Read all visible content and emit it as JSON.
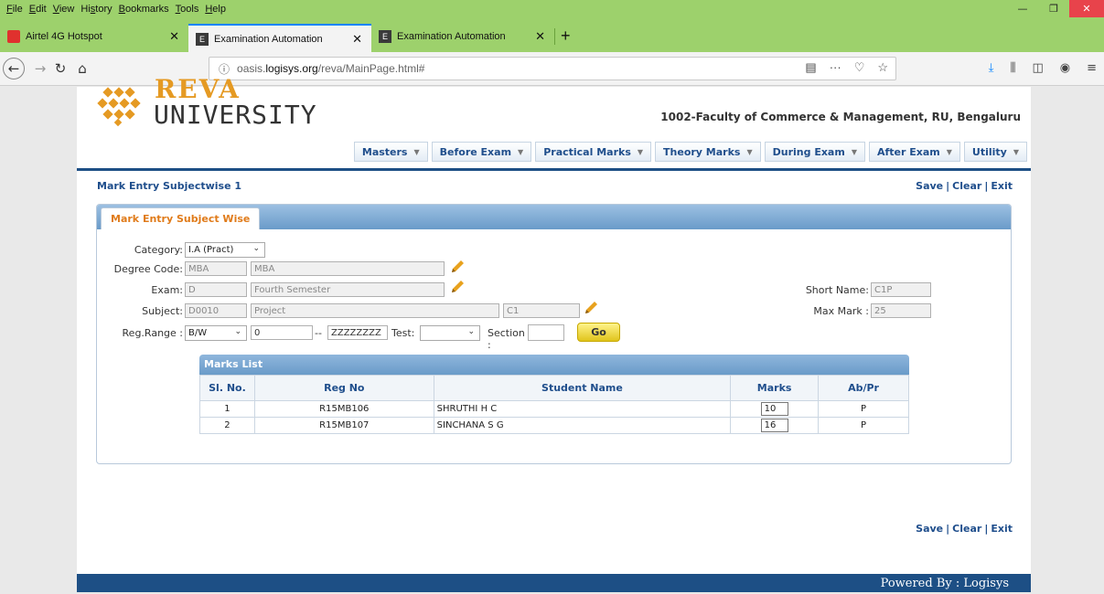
{
  "browser": {
    "menu": [
      {
        "key": "F",
        "rest": "ile"
      },
      {
        "key": "E",
        "rest": "dit"
      },
      {
        "key": "V",
        "rest": "iew"
      },
      {
        "key": "",
        "rest": "History",
        "pre": "Hi",
        "ul": "s",
        "post": "tory"
      },
      {
        "key": "B",
        "rest": "ookmarks"
      },
      {
        "key": "T",
        "rest": "ools"
      },
      {
        "key": "H",
        "rest": "elp"
      }
    ],
    "tabs": [
      {
        "label": "Airtel 4G Hotspot"
      },
      {
        "label": "Examination Automation"
      },
      {
        "label": "Examination Automation"
      }
    ],
    "url_prefix": "oasis.",
    "url_domain": "logisys.org",
    "url_path": "/reva/MainPage.html#",
    "info_icon": "ⓘ"
  },
  "brand": {
    "reva": "REVA",
    "university": "UNIVERSITY",
    "faculty": "1002-Faculty of Commerce & Management, RU, Bengaluru"
  },
  "menu": [
    "Masters",
    "Before Exam",
    "Practical Marks",
    "Theory Marks",
    "During Exam",
    "After Exam",
    "Utility"
  ],
  "page": {
    "heading": "Mark Entry Subjectwise 1",
    "save": "Save",
    "clear": "Clear",
    "exit": "Exit",
    "panel_tab": "Mark Entry Subject Wise"
  },
  "form": {
    "category_label": "Category:",
    "category_value": "I.A (Pract)",
    "degree_label": "Degree Code:",
    "degree_code": "MBA",
    "degree_name": "MBA",
    "exam_label": "Exam:",
    "exam_code": "D",
    "exam_name": "Fourth Semester",
    "subject_label": "Subject:",
    "subject_code": "D0010",
    "subject_name": "Project",
    "subject_short": "C1",
    "short_name_label": "Short Name:",
    "short_name": "C1P",
    "max_mark_label": "Max Mark :",
    "max_mark": "25",
    "regrange_label": "Reg.Range :",
    "regrange_value": "B/W",
    "reg_from": "0",
    "reg_sep": "--",
    "reg_to": "ZZZZZZZZ",
    "test_label": "Test:",
    "test_value": "",
    "section_label": "Section :",
    "section_value": "",
    "go": "Go"
  },
  "marks_list": {
    "title": "Marks List",
    "headers": [
      "Sl. No.",
      "Reg No",
      "Student Name",
      "Marks",
      "Ab/Pr"
    ],
    "rows": [
      {
        "sl": "1",
        "reg": "R15MB106",
        "name": "SHRUTHI H C",
        "marks": "10",
        "abpr": "P"
      },
      {
        "sl": "2",
        "reg": "R15MB107",
        "name": "SINCHANA S G",
        "marks": "16",
        "abpr": "P"
      }
    ]
  },
  "footer": "Powered By  :  Logisys",
  "colors": {
    "browser_chrome": "#9dd16c",
    "brand_blue": "#1d4f85",
    "link_blue": "#1f4e8c",
    "reva_orange": "#e59a23",
    "tab_orange": "#e07b1a",
    "go_yellow": "#f0d83a"
  }
}
